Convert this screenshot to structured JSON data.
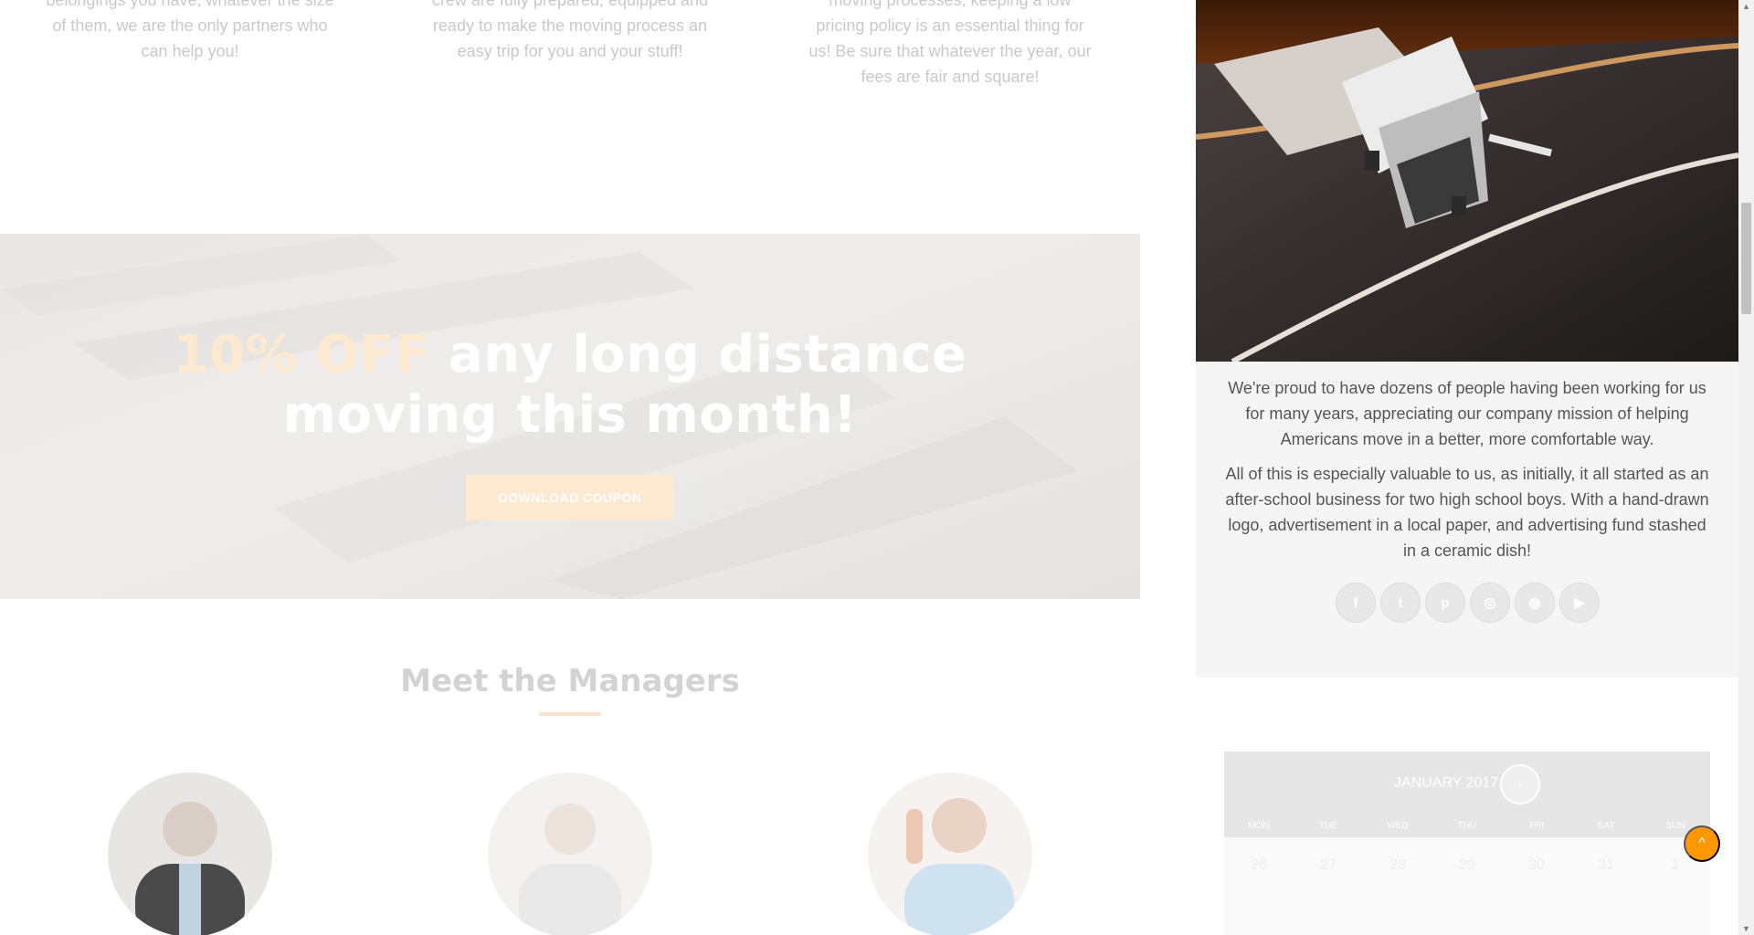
{
  "features": [
    {
      "text": "belongings you have, whatever the size of them, we are the only partners who can help you!"
    },
    {
      "text": "crew are fully prepared, equipped and ready to make the moving process an easy trip for you and your stuff!"
    },
    {
      "text": "moving processes, keeping a low pricing policy is an essential thing for us! Be sure that whatever the year, our fees are fair and square!"
    }
  ],
  "promo": {
    "accent": "10% OFF",
    "title_rest_line1": " any long distance",
    "title_line2": "moving this month!",
    "button_label": "DOWNLOAD COUPON"
  },
  "managers": {
    "title": "Meet the Managers"
  },
  "side_panel": {
    "paragraph1": "We're proud to have dozens of people having been working for us for many years, appreciating our company mission of helping Americans move in a better, more comfortable way.",
    "paragraph2": "All of this is especially valuable to us, as initially, it all started as an after-school business for two high school boys. With a hand-drawn logo, advertisement in a local paper, and advertising fund stashed in a ceramic dish!",
    "socials": [
      {
        "icon": "facebook-icon",
        "glyph": "f"
      },
      {
        "icon": "twitter-icon",
        "glyph": "t"
      },
      {
        "icon": "pinterest-icon",
        "glyph": "p"
      },
      {
        "icon": "instagram-icon",
        "glyph": "◎"
      },
      {
        "icon": "dribbble-icon",
        "glyph": "◍"
      },
      {
        "icon": "youtube-icon",
        "glyph": "▶"
      }
    ]
  },
  "calendar": {
    "month": "JANUARY 2017",
    "next_glyph": "›",
    "weekdays": [
      "MON",
      "TUE",
      "WED",
      "THU",
      "FRI",
      "SAT",
      "SUN"
    ],
    "first_row": [
      "26",
      "27",
      "28",
      "29",
      "30",
      "31",
      "1"
    ]
  },
  "back_to_top": {
    "glyph": "^"
  },
  "colors": {
    "accent": "#ff9800",
    "promo_accent": "#fde9cf"
  }
}
